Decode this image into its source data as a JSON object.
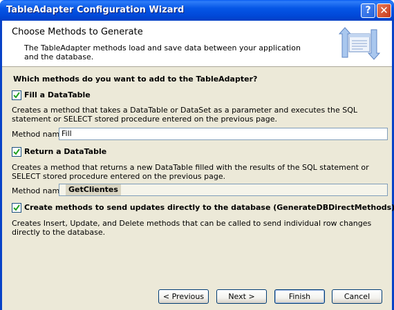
{
  "window": {
    "title": "TableAdapter Configuration Wizard",
    "help_label": "?",
    "close_label": "✕"
  },
  "header": {
    "title": "Choose Methods to Generate",
    "description": "The TableAdapter methods load and save data between your application and the database.",
    "icon": "wizard-methods-icon"
  },
  "main": {
    "question": "Which methods do you want to add to the TableAdapter?",
    "fill": {
      "checked": true,
      "label": "Fill a DataTable",
      "description": "Creates a method that takes a DataTable or DataSet as a parameter and executes the SQL statement or SELECT stored procedure entered on the previous page.",
      "method_label": "Method name:",
      "method_value": "Fill"
    },
    "return": {
      "checked": true,
      "label": "Return a DataTable",
      "description": "Creates a method that returns a new DataTable filled with the results of the SQL statement or SELECT stored procedure entered on the previous page.",
      "method_label": "Method name:",
      "method_value": "GetClientes"
    },
    "update": {
      "checked": true,
      "label": "Create methods to send updates directly to the database (GenerateDBDirectMethods)",
      "description": "Creates Insert, Update, and Delete methods that can be called to send individual row changes directly to the database."
    }
  },
  "footer": {
    "previous": "< Previous",
    "next": "Next >",
    "finish": "Finish",
    "cancel": "Cancel"
  },
  "colors": {
    "titlebar": "#0556e6",
    "client_bg": "#ece9d8",
    "header_bg": "#ffffff"
  }
}
